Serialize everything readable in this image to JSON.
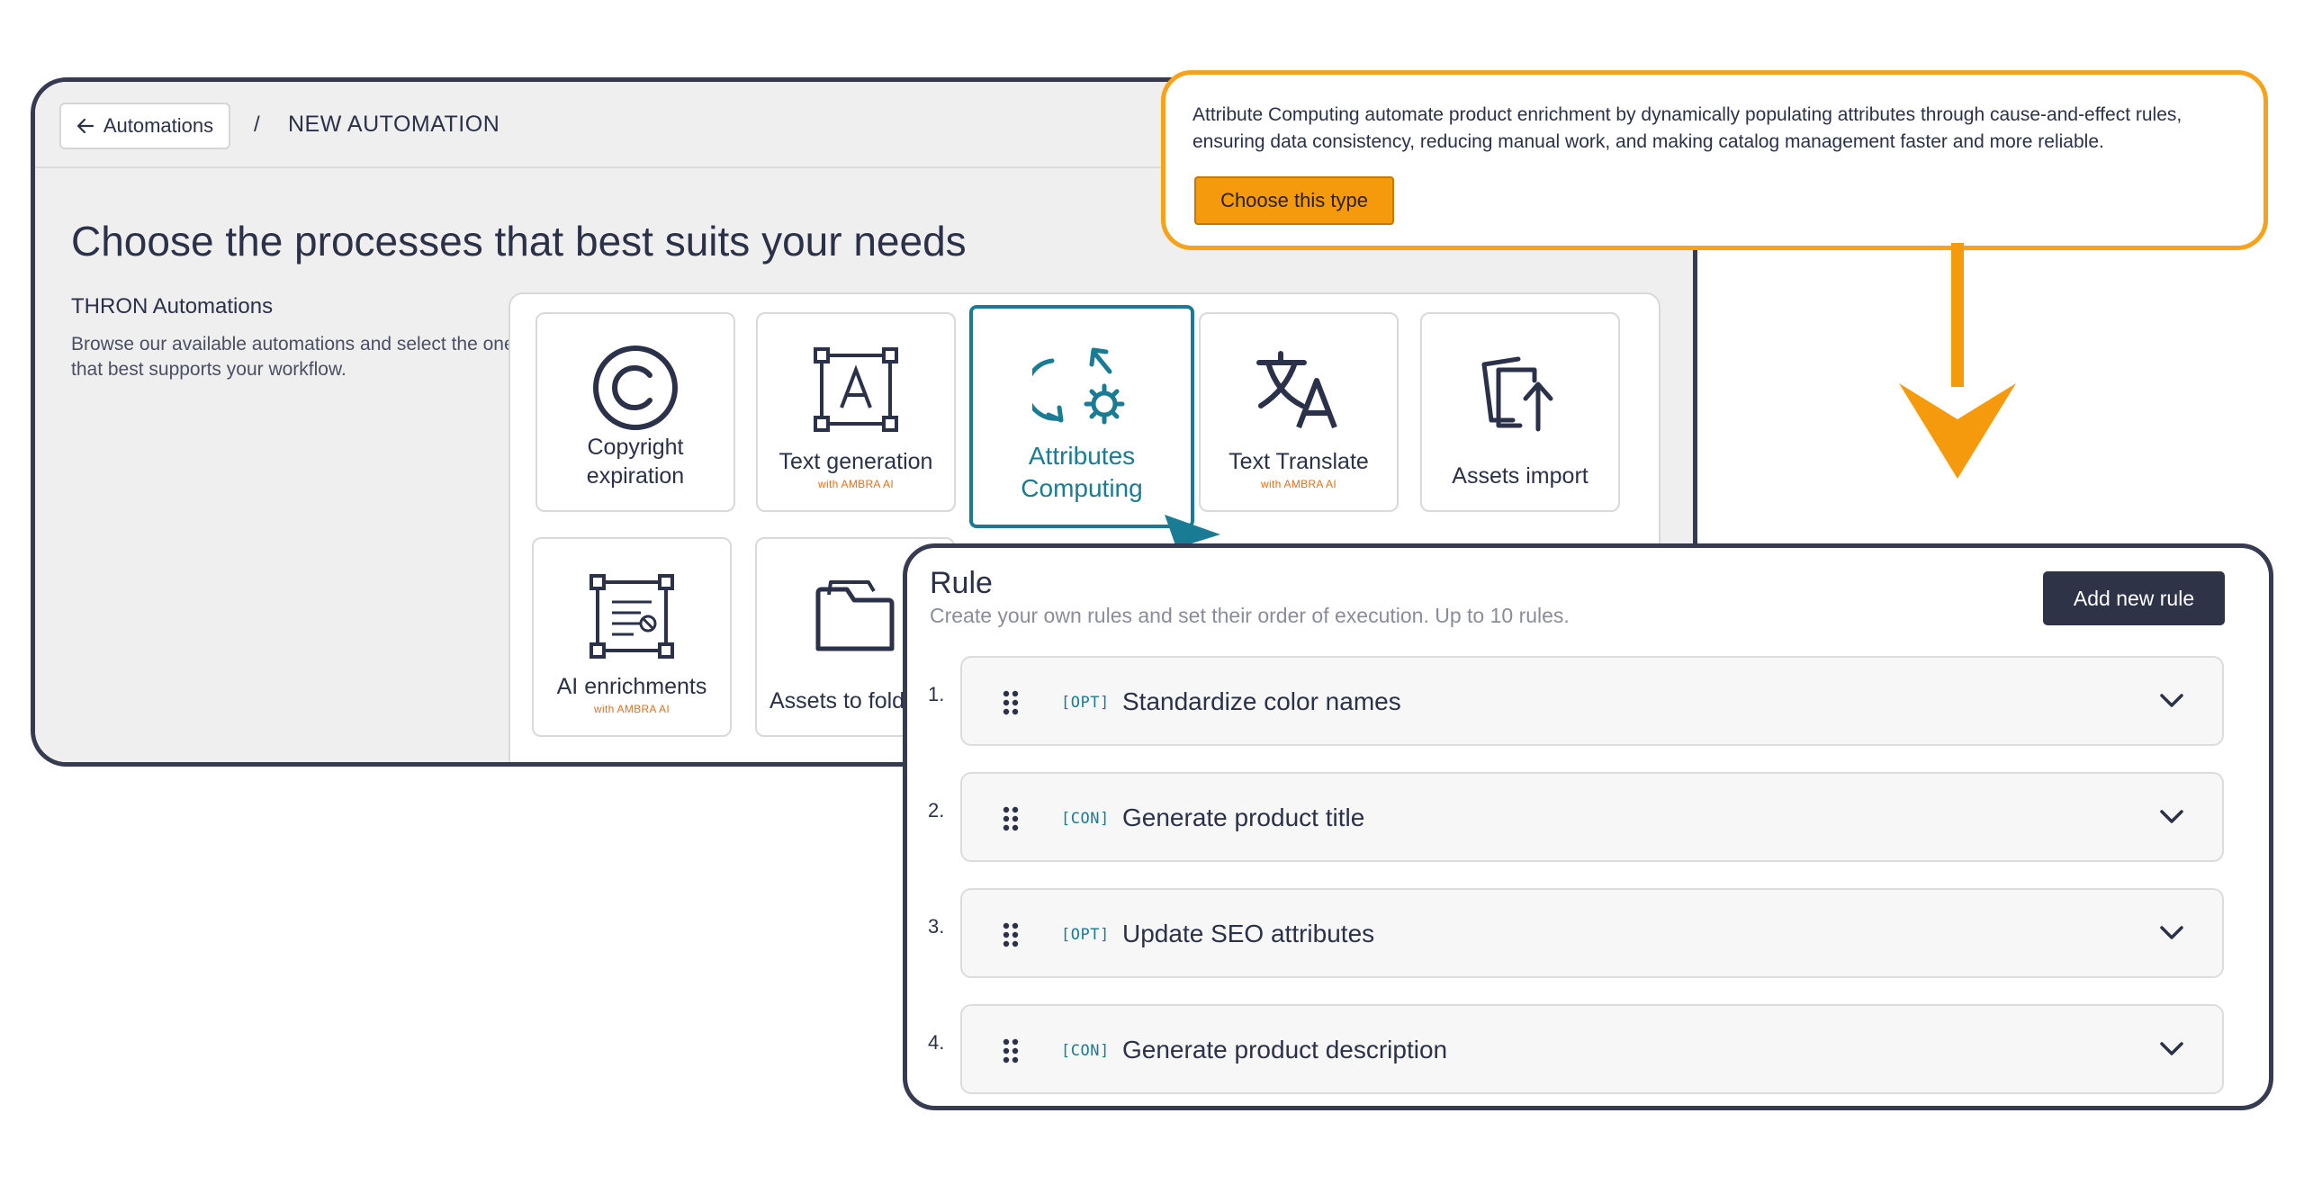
{
  "colors": {
    "window_border": "#363b52",
    "accent_teal": "#1a7c94",
    "accent_orange": "#f7a21b",
    "ambra_orange": "#e3701e",
    "text_dark": "#2b3149",
    "button_dark": "#2e3348"
  },
  "header": {
    "back_label": "Automations",
    "separator": "/",
    "current": "NEW AUTOMATION"
  },
  "main": {
    "title": "Choose the processes that best suits your needs",
    "section_title": "THRON Automations",
    "section_desc": "Browse our available automations and select the one that best supports your workflow.",
    "cards": [
      {
        "label": "Copyright expiration",
        "sub": "",
        "icon": "copyright-icon"
      },
      {
        "label": "Text generation",
        "sub": "with AMBRA AI",
        "icon": "text-generation-icon"
      },
      {
        "label": "Attributes Computing",
        "sub": "",
        "icon": "attributes-computing-icon",
        "selected": true
      },
      {
        "label": "Text Translate",
        "sub": "with AMBRA AI",
        "icon": "translate-icon"
      },
      {
        "label": "Assets import",
        "sub": "",
        "icon": "assets-import-icon"
      },
      {
        "label": "AI enrichments",
        "sub": "with AMBRA AI",
        "icon": "ai-enrichments-icon"
      },
      {
        "label": "Assets to fold",
        "sub": "",
        "icon": "folder-icon"
      }
    ]
  },
  "tooltip": {
    "text": "Attribute Computing automate product enrichment by dynamically populating attributes through cause-and-effect rules, ensuring data consistency, reducing manual work, and making catalog management faster and more reliable.",
    "button_label": "Choose this type"
  },
  "rules": {
    "title": "Rule",
    "desc": "Create your own rules and set their order of execution. Up to 10 rules.",
    "add_label": "Add new rule",
    "items": [
      {
        "num": "1.",
        "tag": "[OPT]",
        "name": "Standardize color names"
      },
      {
        "num": "2.",
        "tag": "[CON]",
        "name": "Generate product title"
      },
      {
        "num": "3.",
        "tag": "[OPT]",
        "name": "Update SEO attributes"
      },
      {
        "num": "4.",
        "tag": "[CON]",
        "name": "Generate product description"
      }
    ]
  }
}
